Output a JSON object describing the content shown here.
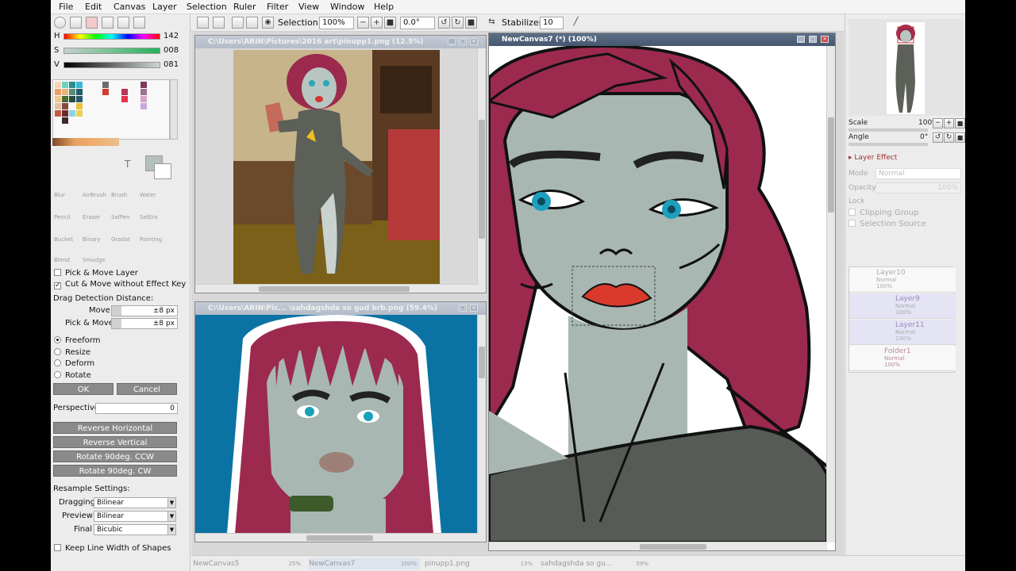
{
  "menu": [
    "File",
    "Edit",
    "Canvas",
    "Layer",
    "Selection",
    "Ruler",
    "Filter",
    "View",
    "Window",
    "Help"
  ],
  "toolbar": {
    "selection_label": "Selection",
    "zoom": "100%",
    "rotation": "0.0°",
    "stabilizer_label": "Stabilizer",
    "stabilizer_value": "10"
  },
  "color": {
    "h_label": "H",
    "h_value": "142",
    "s_label": "S",
    "s_value": "008",
    "v_label": "V",
    "v_value": "081",
    "current_color": "#b4c0bb"
  },
  "tools": [
    "Blur",
    "AirBrush",
    "Brush",
    "Water",
    "Pencil",
    "Eraser",
    "SelPen",
    "SelEra",
    "Bucket",
    "Binary",
    "Gradat",
    "Painting",
    "Blend",
    "Smudge"
  ],
  "transform": {
    "pick_move_layer": "Pick & Move Layer",
    "cut_move": "Cut & Move without Effect Key",
    "drag_detection": "Drag Detection Distance:",
    "move_label": "Move",
    "move_value": "±8 px",
    "pickmove_label": "Pick & Move",
    "pickmove_value": "±8 px",
    "modes": [
      "Freeform",
      "Resize",
      "Deform",
      "Rotate"
    ],
    "ok": "OK",
    "cancel": "Cancel",
    "perspective_label": "Perspective",
    "perspective_value": "0",
    "reverse_h": "Reverse Horizontal",
    "reverse_v": "Reverse Vertical",
    "rotate_ccw": "Rotate 90deg. CCW",
    "rotate_cw": "Rotate 90deg. CW",
    "resample_label": "Resample Settings:",
    "dragging_label": "Dragging",
    "dragging_value": "Bilinear",
    "preview_label": "Preview",
    "preview_value": "Bilinear",
    "final_label": "Final",
    "final_value": "Bicubic",
    "keep_line": "Keep Line Width of Shapes"
  },
  "windows": {
    "doc1_title": "C:\\Users\\ARIN\\Pictures\\2016 art\\pinupp1.png (12.5%)",
    "doc2_title": "C:\\Users\\ARIN\\Pic... \\sahdagshda so gud brb.png (59.4%)",
    "doc3_title": "NewCanvas7 (*) (100%)"
  },
  "navigator": {
    "scale_label": "Scale",
    "scale_value": "100%",
    "angle_label": "Angle",
    "angle_value": "0°"
  },
  "layers": {
    "effect_label": "Layer Effect",
    "mode_label": "Mode",
    "mode_value": "Normal",
    "opacity_label": "Opacity",
    "opacity_value": "100%",
    "lock_label": "Lock",
    "clipping_label": "Clipping Group",
    "selection_source_label": "Selection Source",
    "items": [
      {
        "name": "Layer10",
        "mode": "Normal",
        "opacity": "100%"
      },
      {
        "name": "Layer9",
        "mode": "Normal",
        "opacity": "100%"
      },
      {
        "name": "Layer11",
        "mode": "Normal",
        "opacity": "100%"
      },
      {
        "name": "Folder1",
        "mode": "Normal",
        "opacity": "100%"
      }
    ]
  },
  "status_tabs": [
    {
      "name": "NewCanvas5",
      "zoom": "25%"
    },
    {
      "name": "NewCanvas7",
      "zoom": "100%"
    },
    {
      "name": "pinupp1.png",
      "zoom": "13%"
    },
    {
      "name": "sahdagshda so gu...",
      "zoom": "59%"
    }
  ]
}
